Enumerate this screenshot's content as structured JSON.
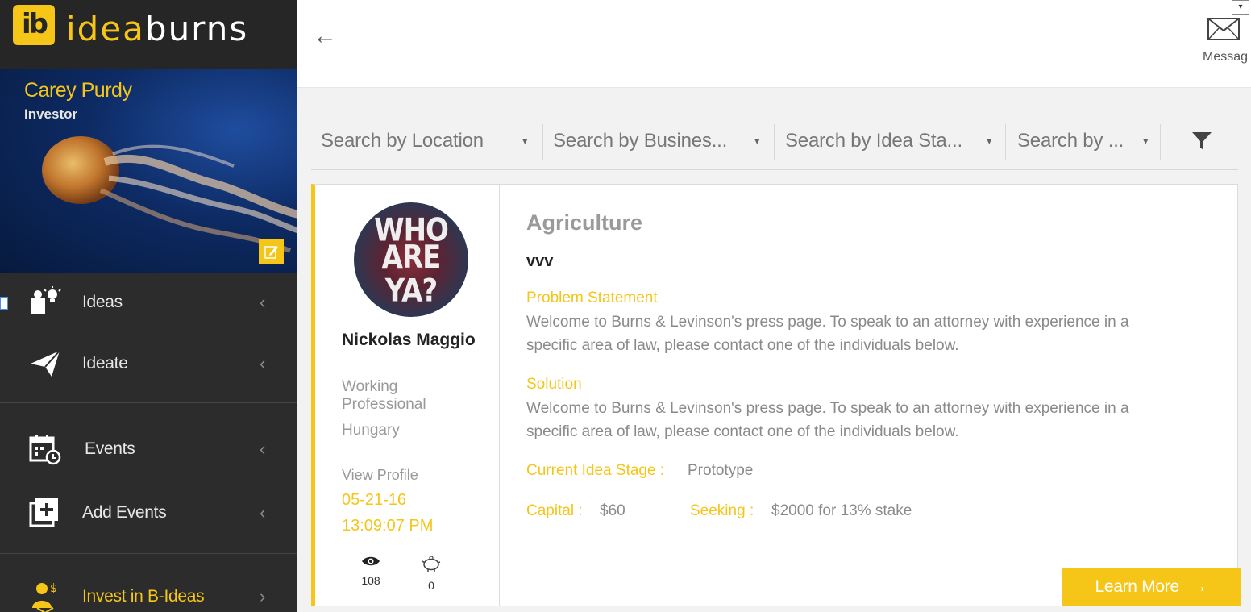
{
  "brand": {
    "logo_mark": "ib",
    "name_part1": "idea",
    "name_part2": "burns"
  },
  "profile": {
    "name": "Carey Purdy",
    "role": "Investor",
    "edit_icon": "pencil-icon"
  },
  "nav": {
    "items": [
      {
        "label": "Ideas",
        "icon": "ideas-icon",
        "chevron": "‹"
      },
      {
        "label": "Ideate",
        "icon": "paper-plane-icon",
        "chevron": "‹"
      },
      {
        "label": "Events",
        "icon": "calendar-icon",
        "chevron": "‹"
      },
      {
        "label": "Add Events",
        "icon": "plus-square-icon",
        "chevron": "‹"
      },
      {
        "label": "Invest in B-Ideas",
        "icon": "investor-icon",
        "chevron": "›"
      }
    ]
  },
  "topbar": {
    "back_arrow": "←",
    "messages_label": "Messag",
    "messages_dropdown": "▾"
  },
  "filters": {
    "location": "Search by Location",
    "business": "Search by Busines...",
    "stage": "Search by Idea Sta...",
    "other": "Search by ...",
    "caret": "▾"
  },
  "card": {
    "avatar_line1": "WHO",
    "avatar_line2": "ARE YA?",
    "person_name": "Nickolas Maggio",
    "person_title": "Working Professional",
    "location": "Hungary",
    "view_profile": "View Profile",
    "date": "05-21-16",
    "time": "13:09:07 PM",
    "views": "108",
    "likes": "0",
    "category": "Agriculture",
    "title": "vvv",
    "problem_label": "Problem Statement",
    "problem_text": "Welcome to Burns & Levinson's press page. To speak to an attorney with experience in a specific area of law, please contact one of the individuals below.",
    "solution_label": "Solution",
    "solution_text": "Welcome to Burns & Levinson's press page. To speak to an attorney with experience in a specific area of law, please contact one of the individuals below.",
    "stage_label": "Current Idea Stage :",
    "stage_value": "Prototype",
    "capital_label": "Capital :",
    "capital_value": "$60",
    "seeking_label": "Seeking :",
    "seeking_value": "$2000 for 13% stake",
    "learn_more": "Learn More",
    "learn_more_arrow": "→"
  },
  "colors": {
    "accent": "#f5c518",
    "sidebar": "#2c2c2c",
    "brand_bg": "#262626"
  }
}
